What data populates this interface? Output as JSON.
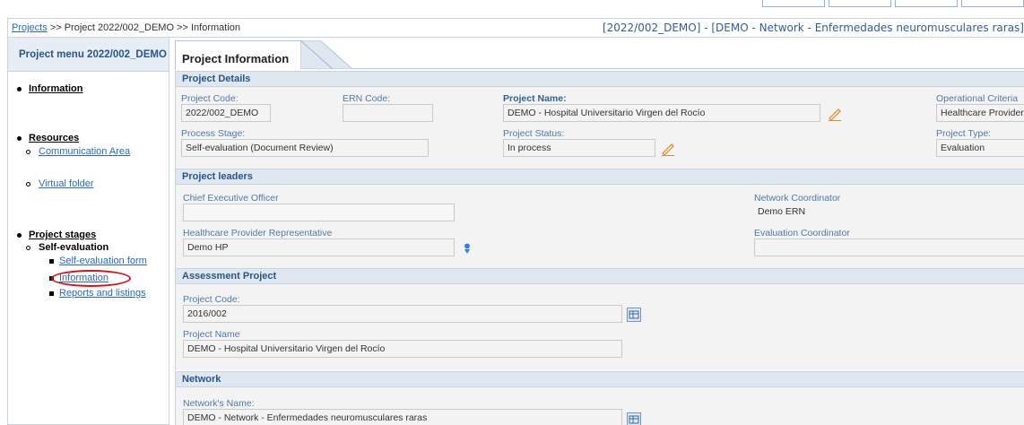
{
  "breadcrumb": {
    "projects_link": "Projects",
    "rest": ">> Project 2022/002_DEMO >> Information"
  },
  "project_heading": "[2022/002_DEMO] - [DEMO - Network - Enfermedades neuromusculares raras]",
  "sidebar": {
    "title": "Project menu 2022/002_DEMO",
    "information": "Information",
    "resources": "Resources",
    "communication_area": "Communication Area",
    "virtual_folder": "Virtual folder",
    "project_stages": "Project stages",
    "self_evaluation": "Self-evaluation",
    "self_evaluation_form": "Self-evaluation form",
    "information_sub": "Information",
    "reports": "Reports and listings"
  },
  "main_tab": "Project Information",
  "project_details": {
    "header": "Project Details",
    "project_code_label": "Project Code:",
    "project_code": "2022/002_DEMO",
    "ern_code_label": "ERN Code:",
    "ern_code": "",
    "project_name_label": "Project Name:",
    "project_name": "DEMO - Hospital Universitario Virgen del Rocío",
    "operational_criteria_label": "Operational Criteria",
    "operational_criteria": "Healthcare Provider",
    "process_stage_label": "Process Stage:",
    "process_stage": "Self-evaluation (Document Review)",
    "project_status_label": "Project Status:",
    "project_status": "In process",
    "project_type_label": "Project Type:",
    "project_type": "Evaluation"
  },
  "project_leaders": {
    "header": "Project leaders",
    "ceo_label": "Chief Executive Officer",
    "ceo": "",
    "network_coordinator_label": "Network Coordinator",
    "network_coordinator": "Demo ERN",
    "hp_rep_label": "Healthcare Provider Representative",
    "hp_rep": "Demo HP",
    "evaluation_coordinator_label": "Evaluation Coordinator",
    "evaluation_coordinator": ""
  },
  "assessment_project": {
    "header": "Assessment Project",
    "project_code_label": "Project Code:",
    "project_code": "2016/002",
    "project_name_label": "Project Name",
    "project_name": "DEMO - Hospital Universitario Virgen del Rocío"
  },
  "network": {
    "header": "Network",
    "name_label": "Network's Name:",
    "name": "DEMO - Network - Enfermedades neuromusculares raras"
  },
  "colors": {
    "accent": "#2a5587",
    "link": "#2a6ab5",
    "highlight_ring": "#d0141c",
    "pencil": "#e0862a"
  }
}
